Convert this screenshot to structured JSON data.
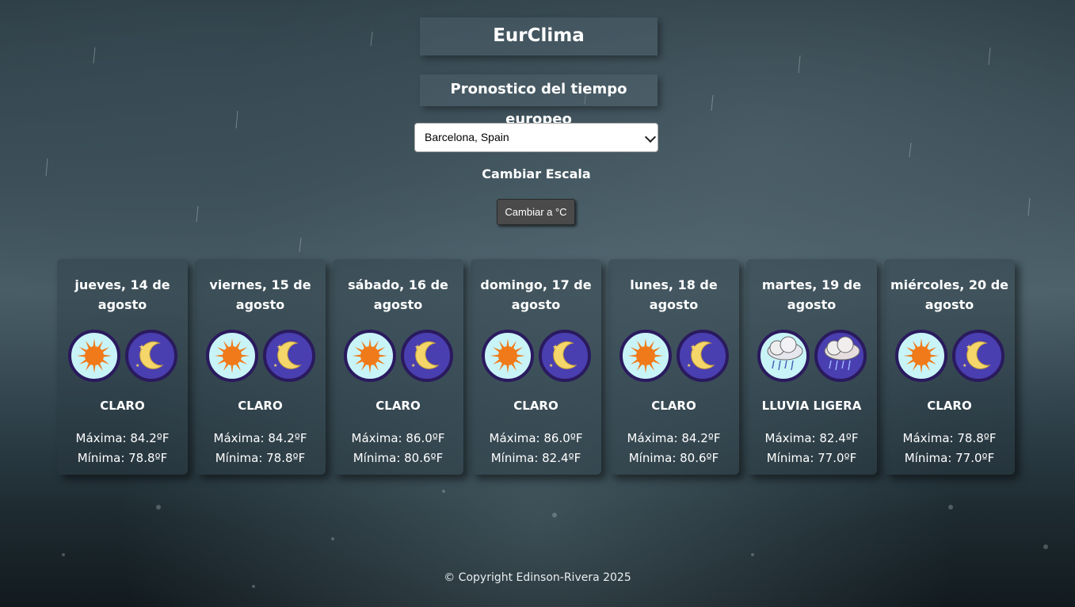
{
  "app": {
    "title": "EurClima",
    "subtitle": "Pronostico del tiempo europeo"
  },
  "location": {
    "selected": "Barcelona, Spain"
  },
  "scale": {
    "label": "Cambiar Escala",
    "button_label": "Cambiar a °C"
  },
  "forecast": [
    {
      "date": "jueves, 14 de agosto",
      "condition": "CLARO",
      "day_icon": "sun-icon",
      "night_icon": "moon-icon",
      "max": "Máxima: 84.2ºF",
      "min": "Mínima: 78.8ºF"
    },
    {
      "date": "viernes, 15 de agosto",
      "condition": "CLARO",
      "day_icon": "sun-icon",
      "night_icon": "moon-icon",
      "max": "Máxima: 84.2ºF",
      "min": "Mínima: 78.8ºF"
    },
    {
      "date": "sábado, 16 de agosto",
      "condition": "CLARO",
      "day_icon": "sun-icon",
      "night_icon": "moon-icon",
      "max": "Máxima: 86.0ºF",
      "min": "Mínima: 80.6ºF"
    },
    {
      "date": "domingo, 17 de agosto",
      "condition": "CLARO",
      "day_icon": "sun-icon",
      "night_icon": "moon-icon",
      "max": "Máxima: 86.0ºF",
      "min": "Mínima: 82.4ºF"
    },
    {
      "date": "lunes, 18 de agosto",
      "condition": "CLARO",
      "day_icon": "sun-icon",
      "night_icon": "moon-icon",
      "max": "Máxima: 84.2ºF",
      "min": "Mínima: 80.6ºF"
    },
    {
      "date": "martes, 19 de agosto",
      "condition": "LLUVIA LIGERA",
      "day_icon": "rain-cloud-day-icon",
      "night_icon": "rain-cloud-night-icon",
      "max": "Máxima: 82.4ºF",
      "min": "Mínima: 77.0ºF"
    },
    {
      "date": "miércoles, 20 de agosto",
      "condition": "CLARO",
      "day_icon": "sun-icon",
      "night_icon": "moon-icon",
      "max": "Máxima: 78.8ºF",
      "min": "Mínima: 77.0ºF"
    }
  ],
  "footer": {
    "copyright": "© Copyright Edinson-Rivera 2025"
  },
  "colors": {
    "icon_ring": "#2a1a5e",
    "day_bg": "#c8f4f8",
    "night_bg": "#4a3fb0",
    "sun": "#f07a1a",
    "moon": "#f5d66a",
    "button_bg": "#4a4a4a"
  }
}
